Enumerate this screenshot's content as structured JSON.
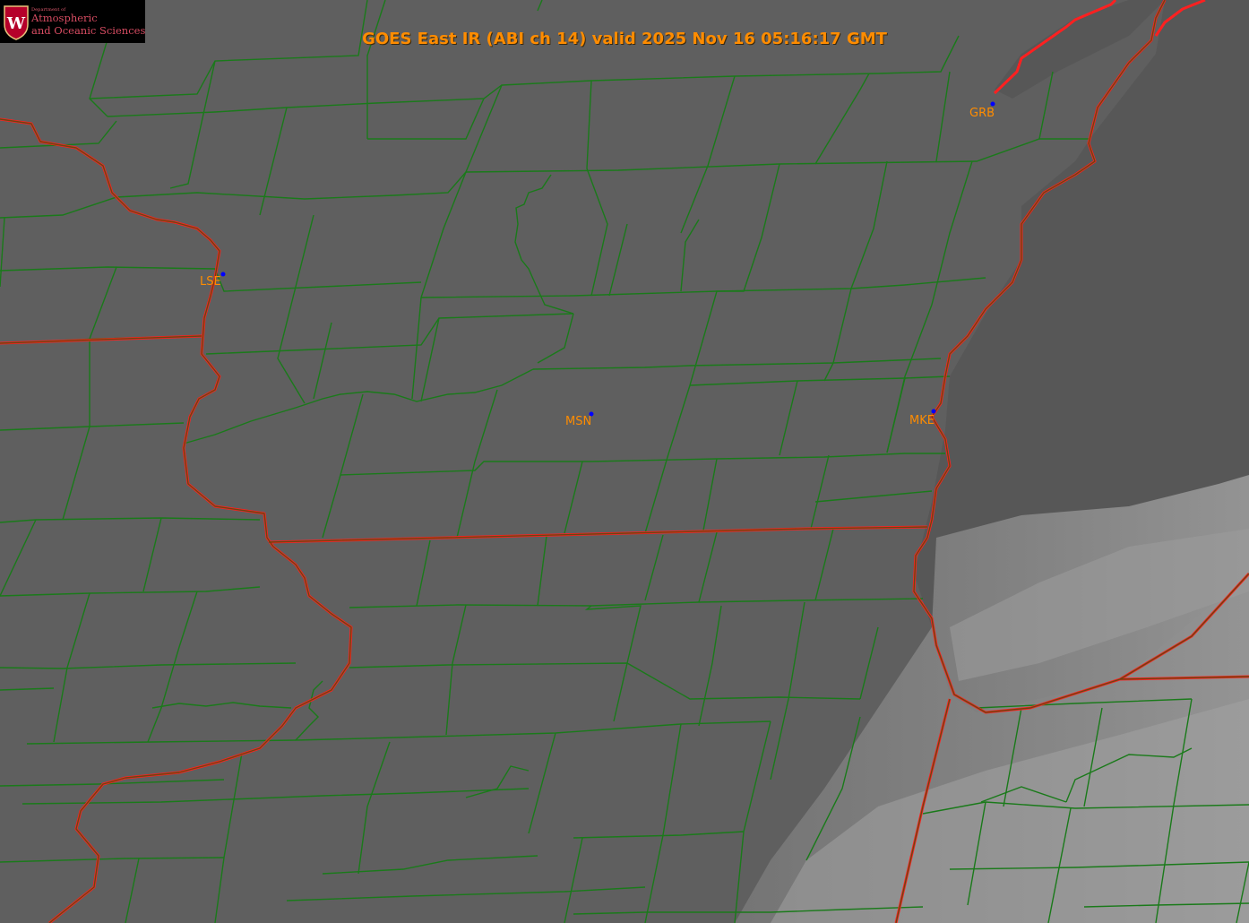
{
  "logo": {
    "dept_line": "Department of",
    "name_line1": "Atmospheric",
    "name_line2": "and Oceanic Sciences",
    "seal_letter": "W"
  },
  "title": "GOES East IR (ABI ch 14) valid 2025 Nov 16 05:16:17 GMT",
  "stations": [
    {
      "id": "LSE",
      "label": "LSE"
    },
    {
      "id": "GRB",
      "label": "GRB"
    },
    {
      "id": "MSN",
      "label": "MSN"
    },
    {
      "id": "MKE",
      "label": "MKE"
    }
  ],
  "colors": {
    "county_lines": "#1a7a1a",
    "state_lines": "#ff2020",
    "labels": "#ff8c00",
    "station_dots": "#0000ff",
    "background_gray": "#5f5f5f"
  }
}
